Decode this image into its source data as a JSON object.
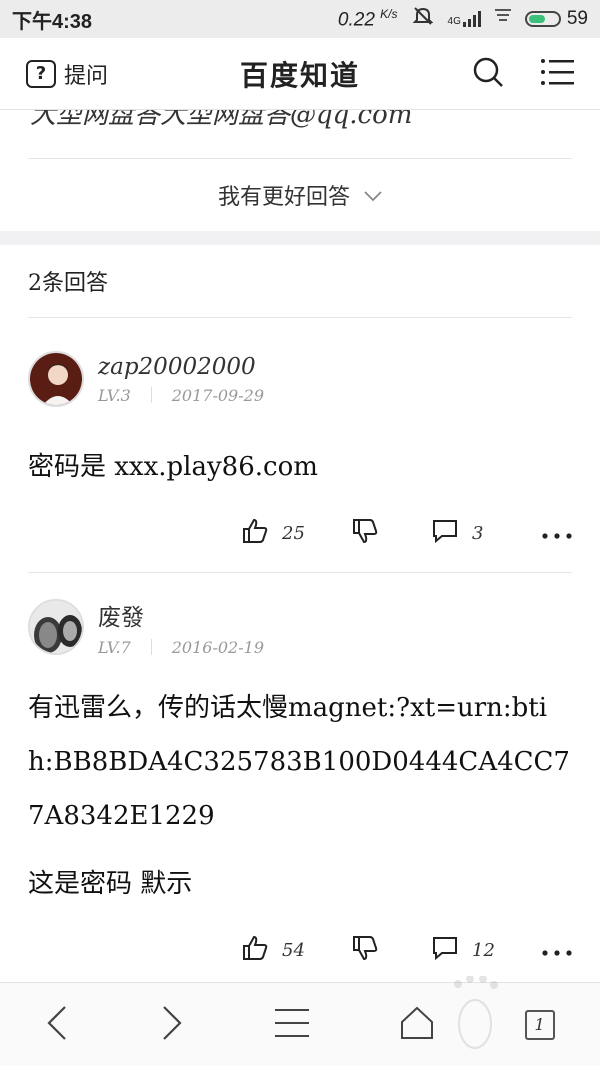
{
  "status_bar": {
    "time": "下午4:38",
    "network_speed": "0.22",
    "network_unit": "K/s",
    "signal_label": "4G",
    "battery": "59",
    "battery_level_percent": 59
  },
  "top_nav": {
    "ask_label": "提问",
    "ask_icon_glyph": "?",
    "brand_title": "百度知道"
  },
  "question": {
    "partial_text": "大型网盘答大型网盘答@qq.com",
    "better_answer_label": "我有更好回答"
  },
  "answers_count_label": "2条回答",
  "answers": [
    {
      "username": "zap20002000",
      "level": "LV.3",
      "date": "2017-09-29",
      "paragraphs": [
        "密码是  xxx.play86.com"
      ],
      "likes": "25",
      "comments": "3"
    },
    {
      "username": "废發",
      "level": "LV.7",
      "date": "2016-02-19",
      "paragraphs": [
        "有迅雷么，传的话太慢magnet:?xt=urn:btih:BB8BDA4C325783B100D0444CA4CC77A8342E1229",
        "这是密码  默示"
      ],
      "likes": "54",
      "comments": "12"
    }
  ],
  "bottom_bar": {
    "tabs_count": "1"
  },
  "colors": {
    "accent_battery": "#3bbf7a",
    "gap_bar": "#f1f1f3"
  }
}
